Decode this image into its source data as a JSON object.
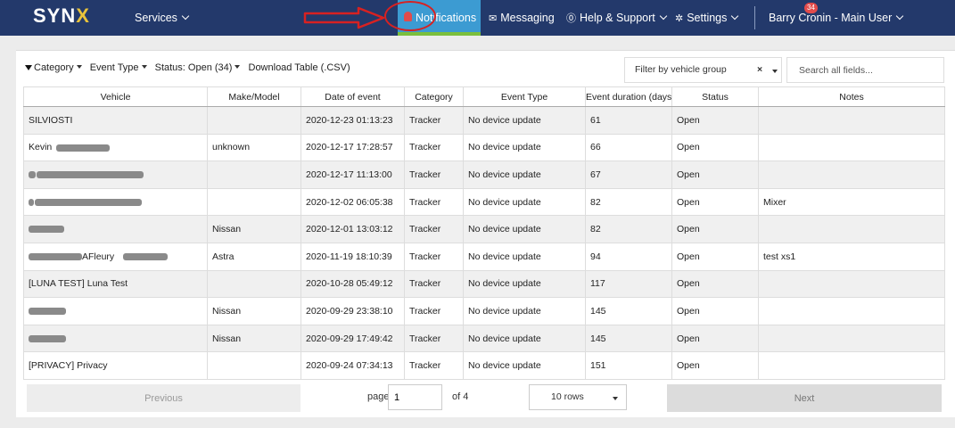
{
  "navbar": {
    "logo": "SYN",
    "logo_accent": "X",
    "services_label": "Services",
    "notifications_label": "Notifications",
    "notifications_badge": "34",
    "messaging_label": "Messaging",
    "help_label": "Help & Support",
    "settings_label": "Settings",
    "user_label": "Barry Cronin - Main User"
  },
  "toolbar": {
    "category_label": "Category",
    "event_type_label": "Event Type",
    "status_label": "Status: Open (34)",
    "download_label": "Download Table (.CSV)",
    "vehicle_group_placeholder": "Filter by vehicle group",
    "clear_symbol": "×",
    "search_placeholder": "Search all fields..."
  },
  "table": {
    "columns": [
      "Vehicle",
      "Make/Model",
      "Date of event",
      "Category",
      "Event Type",
      "Event duration (days)",
      "Status",
      "Notes"
    ],
    "rows": [
      {
        "vehicle": "SILVIOSTI",
        "make": "",
        "date": "2020-12-23 01:13:23",
        "category": "Tracker",
        "event_type": "No device update",
        "duration": "61",
        "status": "Open",
        "notes": ""
      },
      {
        "vehicle": "Kevin",
        "make": "unknown",
        "date": "2020-12-17 17:28:57",
        "category": "Tracker",
        "event_type": "No device update",
        "duration": "66",
        "status": "Open",
        "notes": ""
      },
      {
        "vehicle": "",
        "make": "",
        "date": "2020-12-17 11:13:00",
        "category": "Tracker",
        "event_type": "No device update",
        "duration": "67",
        "status": "Open",
        "notes": ""
      },
      {
        "vehicle": "",
        "make": "",
        "date": "2020-12-02 06:05:38",
        "category": "Tracker",
        "event_type": "No device update",
        "duration": "82",
        "status": "Open",
        "notes": "Mixer"
      },
      {
        "vehicle": "",
        "make": "Nissan",
        "date": "2020-12-01 13:03:12",
        "category": "Tracker",
        "event_type": "No device update",
        "duration": "82",
        "status": "Open",
        "notes": ""
      },
      {
        "vehicle": "AFleury",
        "make": "Astra",
        "date": "2020-11-19 18:10:39",
        "category": "Tracker",
        "event_type": "No device update",
        "duration": "94",
        "status": "Open",
        "notes": "test xs1"
      },
      {
        "vehicle": "[LUNA TEST] Luna Test",
        "make": "",
        "date": "2020-10-28 05:49:12",
        "category": "Tracker",
        "event_type": "No device update",
        "duration": "117",
        "status": "Open",
        "notes": ""
      },
      {
        "vehicle": "",
        "make": "Nissan",
        "date": "2020-09-29 23:38:10",
        "category": "Tracker",
        "event_type": "No device update",
        "duration": "145",
        "status": "Open",
        "notes": ""
      },
      {
        "vehicle": "",
        "make": "Nissan",
        "date": "2020-09-29 17:49:42",
        "category": "Tracker",
        "event_type": "No device update",
        "duration": "145",
        "status": "Open",
        "notes": ""
      },
      {
        "vehicle": "[PRIVACY] Privacy",
        "make": "",
        "date": "2020-09-24 07:34:13",
        "category": "Tracker",
        "event_type": "No device update",
        "duration": "151",
        "status": "Open",
        "notes": ""
      }
    ]
  },
  "pager": {
    "previous_label": "Previous",
    "page_label": "page",
    "page_value": "1",
    "of_label": "of 4",
    "rows_label": "10 rows",
    "next_label": "Next"
  },
  "colors": {
    "navbar_bg": "#23396b",
    "notifications_bg": "#3c9bd2",
    "accent_green": "#7bbf3c",
    "badge_red": "#e24b4b",
    "annotation_red": "#d82121"
  }
}
